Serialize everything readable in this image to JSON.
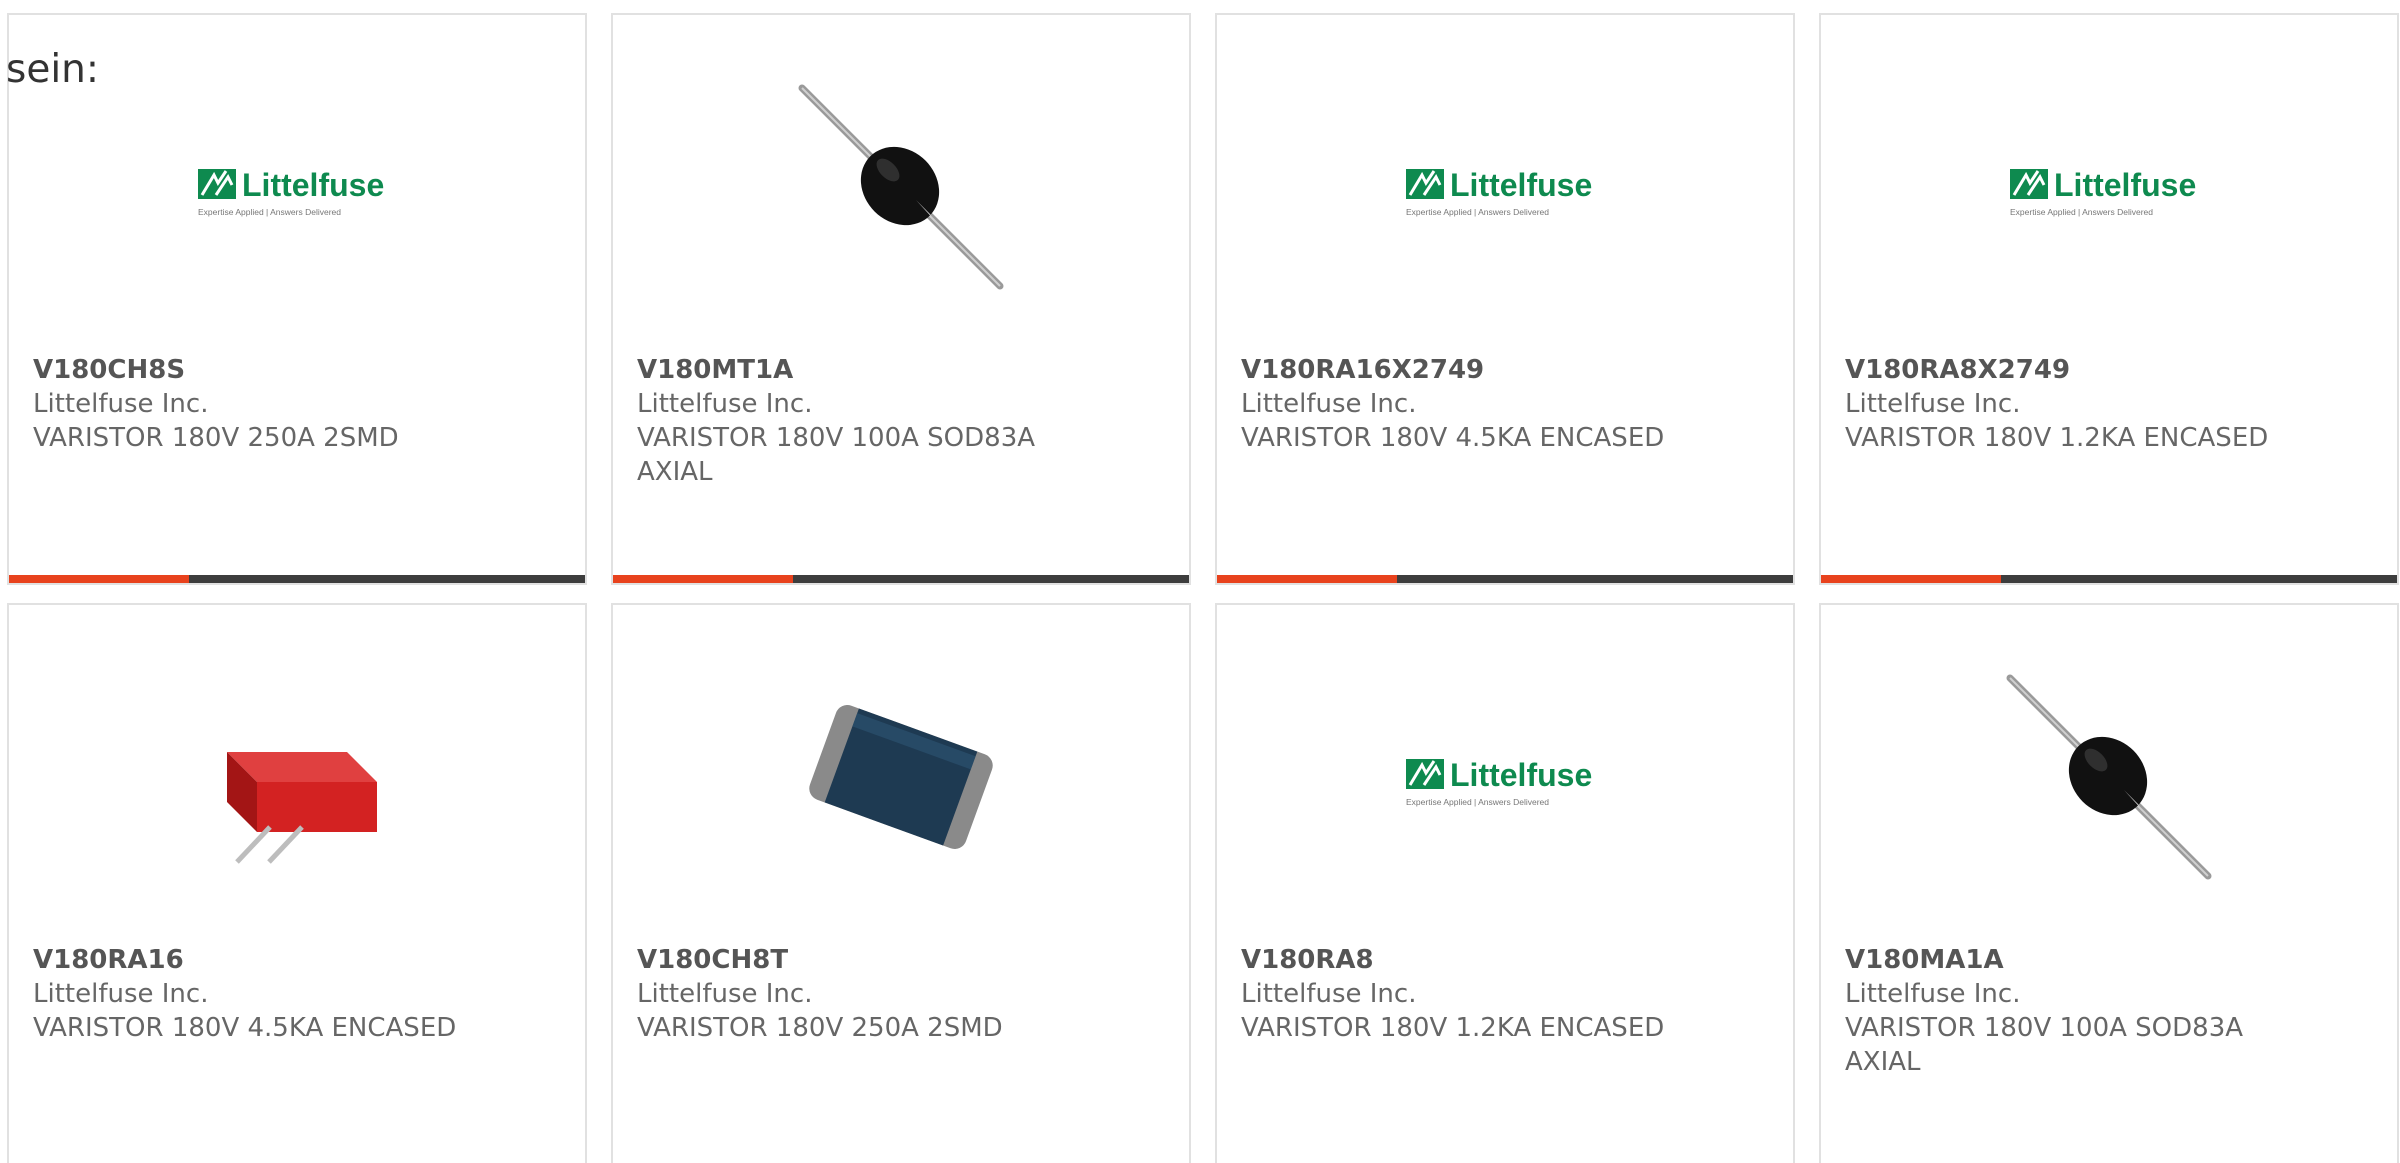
{
  "intro_text": "sein:",
  "colors": {
    "accent": "#e8421d",
    "bar": "#3d3d3d",
    "logo_green": "#0e8a4f",
    "varistor_black": "#111111",
    "block_red": "#d32222",
    "chip_blue": "#1e3a52"
  },
  "logo": {
    "brand": "Littelfuse",
    "tagline": "Expertise Applied | Answers Delivered"
  },
  "products": [
    {
      "part": "V180CH8S",
      "manufacturer": "Littelfuse Inc.",
      "description": "VARISTOR 180V 250A 2SMD",
      "image": "littelfuse-logo",
      "accent_bar": true
    },
    {
      "part": "V180MT1A",
      "manufacturer": "Littelfuse Inc.",
      "description": "VARISTOR 180V 100A SOD83A AXIAL",
      "image": "axial-varistor",
      "accent_bar": true
    },
    {
      "part": "V180RA16X2749",
      "manufacturer": "Littelfuse Inc.",
      "description": "VARISTOR 180V 4.5KA ENCASED",
      "image": "littelfuse-logo",
      "accent_bar": true
    },
    {
      "part": "V180RA8X2749",
      "manufacturer": "Littelfuse Inc.",
      "description": "VARISTOR 180V 1.2KA ENCASED",
      "image": "littelfuse-logo",
      "accent_bar": true
    },
    {
      "part": "V180RA16",
      "manufacturer": "Littelfuse Inc.",
      "description": "VARISTOR 180V 4.5KA ENCASED",
      "image": "red-encased-varistor",
      "accent_bar": false
    },
    {
      "part": "V180CH8T",
      "manufacturer": "Littelfuse Inc.",
      "description": "VARISTOR 180V 250A 2SMD",
      "image": "smd-chip-varistor",
      "accent_bar": false
    },
    {
      "part": "V180RA8",
      "manufacturer": "Littelfuse Inc.",
      "description": "VARISTOR 180V 1.2KA ENCASED",
      "image": "littelfuse-logo",
      "accent_bar": false
    },
    {
      "part": "V180MA1A",
      "manufacturer": "Littelfuse Inc.",
      "description": "VARISTOR 180V 100A SOD83A AXIAL",
      "image": "axial-varistor",
      "accent_bar": false
    }
  ]
}
